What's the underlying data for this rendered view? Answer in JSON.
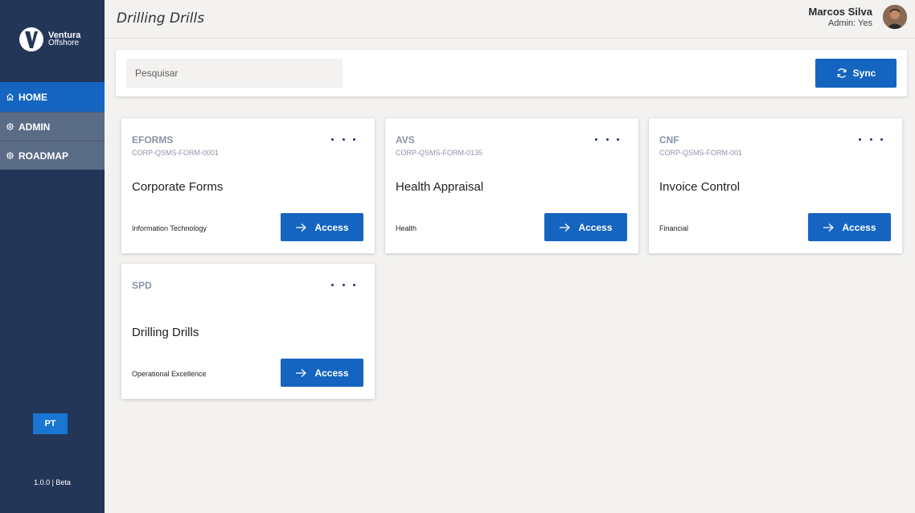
{
  "sidebar": {
    "logo_line1": "Ventura",
    "logo_line2": "Offshore",
    "items": [
      {
        "label": "HOME",
        "icon": "home-icon"
      },
      {
        "label": "ADMIN",
        "icon": "gear-icon"
      },
      {
        "label": "ROADMAP",
        "icon": "gear-icon"
      }
    ],
    "language_button": "PT",
    "version": "1.0.0 | Beta"
  },
  "header": {
    "title": "Drilling Drills",
    "user_name": "Marcos Silva",
    "user_role": "Admin: Yes"
  },
  "search": {
    "placeholder": "Pesquisar",
    "sync_label": "Sync"
  },
  "cards": [
    {
      "code": "EFORMS",
      "form": "CORP-QSMS-FORM-0001",
      "title": "Corporate Forms",
      "department": "Information Technology",
      "access_label": "Access"
    },
    {
      "code": "AVS",
      "form": "CORP-QSMS-FORM-0135",
      "title": "Health Appraisal",
      "department": "Health",
      "access_label": "Access"
    },
    {
      "code": "CNF",
      "form": "CORP-QSMS-FORM-001",
      "title": "Invoice Control",
      "department": "Financial",
      "access_label": "Access"
    },
    {
      "code": "SPD",
      "form": "",
      "title": "Drilling Drills",
      "department": "Operational Excellence",
      "access_label": "Access"
    }
  ],
  "colors": {
    "sidebar_bg": "#243657",
    "accent": "#1565c0",
    "page_bg": "#f3f2f0"
  }
}
